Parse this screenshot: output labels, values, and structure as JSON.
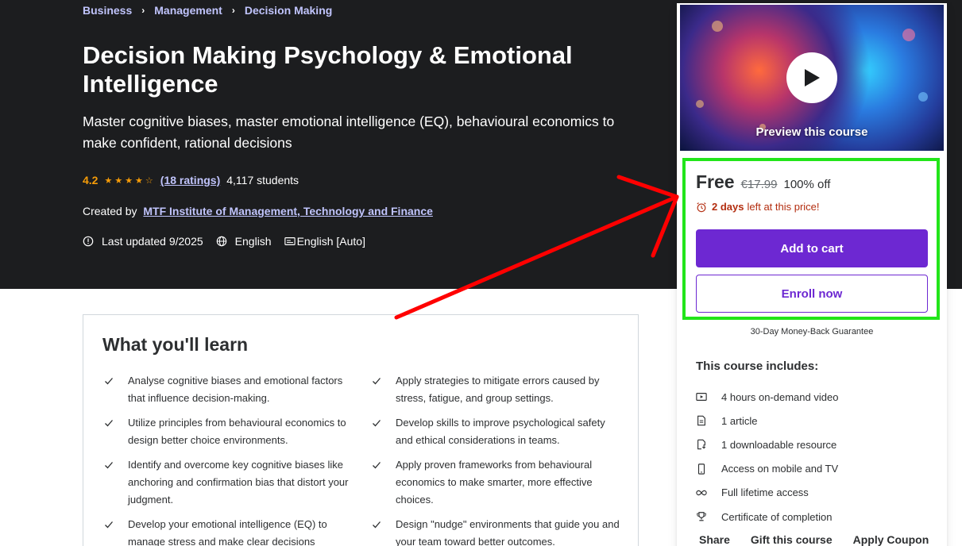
{
  "breadcrumbs": [
    "Business",
    "Management",
    "Decision Making"
  ],
  "course": {
    "title": "Decision Making Psychology & Emotional Intelligence",
    "subtitle": "Master cognitive biases, master emotional intelligence (EQ), behavioural economics to make confident, rational decisions",
    "rating": "4.2",
    "ratings_count": "(18 ratings)",
    "students": "4,117 students",
    "created_by_label": "Created by",
    "instructor": "MTF Institute of Management, Technology and Finance",
    "last_updated": "Last updated 9/2025",
    "language": "English",
    "captions": "English [Auto]"
  },
  "sidebar": {
    "preview_label": "Preview this course",
    "price": "Free",
    "original_price": "€17.99",
    "discount": "100% off",
    "timer_days": "2 days",
    "timer_rest": "left at this price!",
    "add_to_cart": "Add to cart",
    "enroll_now": "Enroll now",
    "guarantee": "30-Day Money-Back Guarantee",
    "includes_title": "This course includes:",
    "includes": [
      {
        "icon": "video-icon",
        "label": "4 hours on-demand video"
      },
      {
        "icon": "article-icon",
        "label": "1 article"
      },
      {
        "icon": "download-icon",
        "label": "1 downloadable resource"
      },
      {
        "icon": "mobile-icon",
        "label": "Access on mobile and TV"
      },
      {
        "icon": "infinity-icon",
        "label": "Full lifetime access"
      },
      {
        "icon": "trophy-icon",
        "label": "Certificate of completion"
      }
    ],
    "actions": [
      "Share",
      "Gift this course",
      "Apply Coupon"
    ]
  },
  "learn": {
    "title": "What you'll learn",
    "left": [
      "Analyse cognitive biases and emotional factors that influence decision-making.",
      "Utilize principles from behavioural economics to design better choice environments.",
      "Identify and overcome key cognitive biases like anchoring and confirmation bias that distort your judgment.",
      "Develop your emotional intelligence (EQ) to manage stress and make clear decisions"
    ],
    "right": [
      "Apply strategies to mitigate errors caused by stress, fatigue, and group settings.",
      "Develop skills to improve psychological safety and ethical considerations in teams.",
      "Apply proven frameworks from behavioural economics to make smarter, more effective choices.",
      "Design \"nudge\" environments that guide you and your team toward better outcomes."
    ]
  },
  "colors": {
    "hero_bg": "#1c1d1f",
    "accent": "#6d28d2",
    "link": "#c0c4fc",
    "star": "#f69c08",
    "timer": "#b32d0f",
    "annotation_arrow": "#ff0000",
    "annotation_box": "#22e51a"
  }
}
